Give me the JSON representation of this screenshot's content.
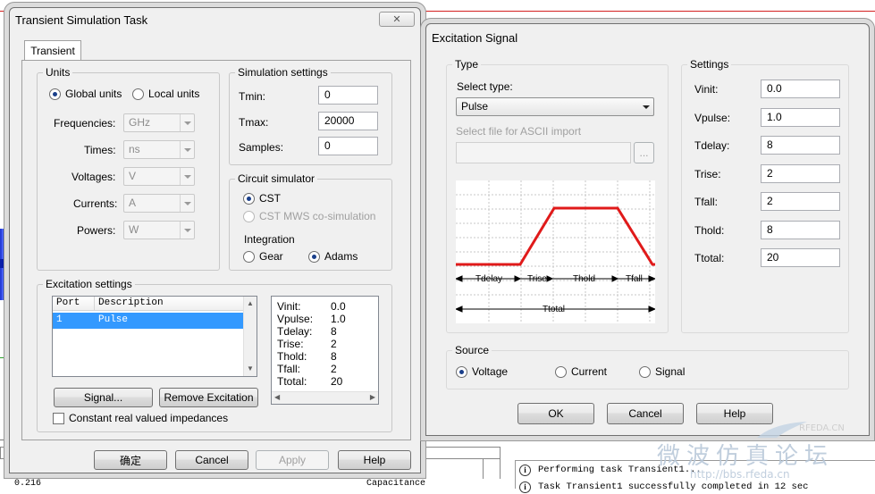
{
  "background": {
    "status_left": "0.216",
    "status_right": "Capacitance",
    "log": [
      "Performing task Transient1...",
      "Task Transient1 successfully completed in 12 sec"
    ]
  },
  "left_window": {
    "title": "Transient Simulation Task",
    "tab": "Transient",
    "units": {
      "title": "Units",
      "global_label": "Global units",
      "local_label": "Local units",
      "selected": "global",
      "rows": [
        {
          "label": "Frequencies:",
          "value": "GHz"
        },
        {
          "label": "Times:",
          "value": "ns"
        },
        {
          "label": "Voltages:",
          "value": "V"
        },
        {
          "label": "Currents:",
          "value": "A"
        },
        {
          "label": "Powers:",
          "value": "W"
        }
      ]
    },
    "sim_settings": {
      "title": "Simulation settings",
      "rows": [
        {
          "label": "Tmin:",
          "value": "0"
        },
        {
          "label": "Tmax:",
          "value": "20000"
        },
        {
          "label": "Samples:",
          "value": "0"
        }
      ]
    },
    "circuit_sim": {
      "title": "Circuit simulator",
      "cst_label": "CST",
      "mws_label": "CST MWS co-simulation",
      "integration_label": "Integration",
      "gear_label": "Gear",
      "adams_label": "Adams",
      "selected_sim": "CST",
      "selected_integration": "Adams"
    },
    "excitation": {
      "title": "Excitation settings",
      "col_port": "Port",
      "col_desc": "Description",
      "rows": [
        {
          "port": "1",
          "description": "Pulse"
        }
      ],
      "summary": [
        {
          "label": "Vinit:",
          "value": "0.0"
        },
        {
          "label": "Vpulse:",
          "value": "1.0"
        },
        {
          "label": "Tdelay:",
          "value": "8"
        },
        {
          "label": "Trise:",
          "value": "2"
        },
        {
          "label": "Thold:",
          "value": "8"
        },
        {
          "label": "Tfall:",
          "value": "2"
        },
        {
          "label": "Ttotal:",
          "value": "20"
        }
      ],
      "signal_btn": "Signal...",
      "remove_btn": "Remove Excitation",
      "const_imp_label": "Constant real valued impedances"
    },
    "buttons": {
      "ok": "确定",
      "cancel": "Cancel",
      "apply": "Apply",
      "help": "Help"
    },
    "close_glyph": "✕"
  },
  "right_window": {
    "title": "Excitation Signal",
    "type": {
      "title": "Type",
      "select_label": "Select type:",
      "selected": "Pulse",
      "ascii_label": "Select file for ASCII import",
      "browse": "..."
    },
    "diagram": {
      "labels": {
        "tdelay": "Tdelay",
        "trise": "Trise",
        "thold": "Thold",
        "tfall": "Tfall",
        "ttotal": "Ttotal"
      },
      "pulse_color": "#e01a1a"
    },
    "settings": {
      "title": "Settings",
      "rows": [
        {
          "label": "Vinit:",
          "value": "0.0"
        },
        {
          "label": "Vpulse:",
          "value": "1.0"
        },
        {
          "label": "Tdelay:",
          "value": "8"
        },
        {
          "label": "Trise:",
          "value": "2"
        },
        {
          "label": "Tfall:",
          "value": "2"
        },
        {
          "label": "Thold:",
          "value": "8"
        },
        {
          "label": "Ttotal:",
          "value": "20"
        }
      ]
    },
    "source": {
      "title": "Source",
      "voltage": "Voltage",
      "current": "Current",
      "signal": "Signal",
      "selected": "Voltage"
    },
    "buttons": {
      "ok": "OK",
      "cancel": "Cancel",
      "help": "Help"
    },
    "close_glyph": "✕"
  },
  "watermark": {
    "brand": "RFEDA.CN",
    "chinese": "微波仿真论坛",
    "url": "http://bbs.rfeda.cn"
  }
}
